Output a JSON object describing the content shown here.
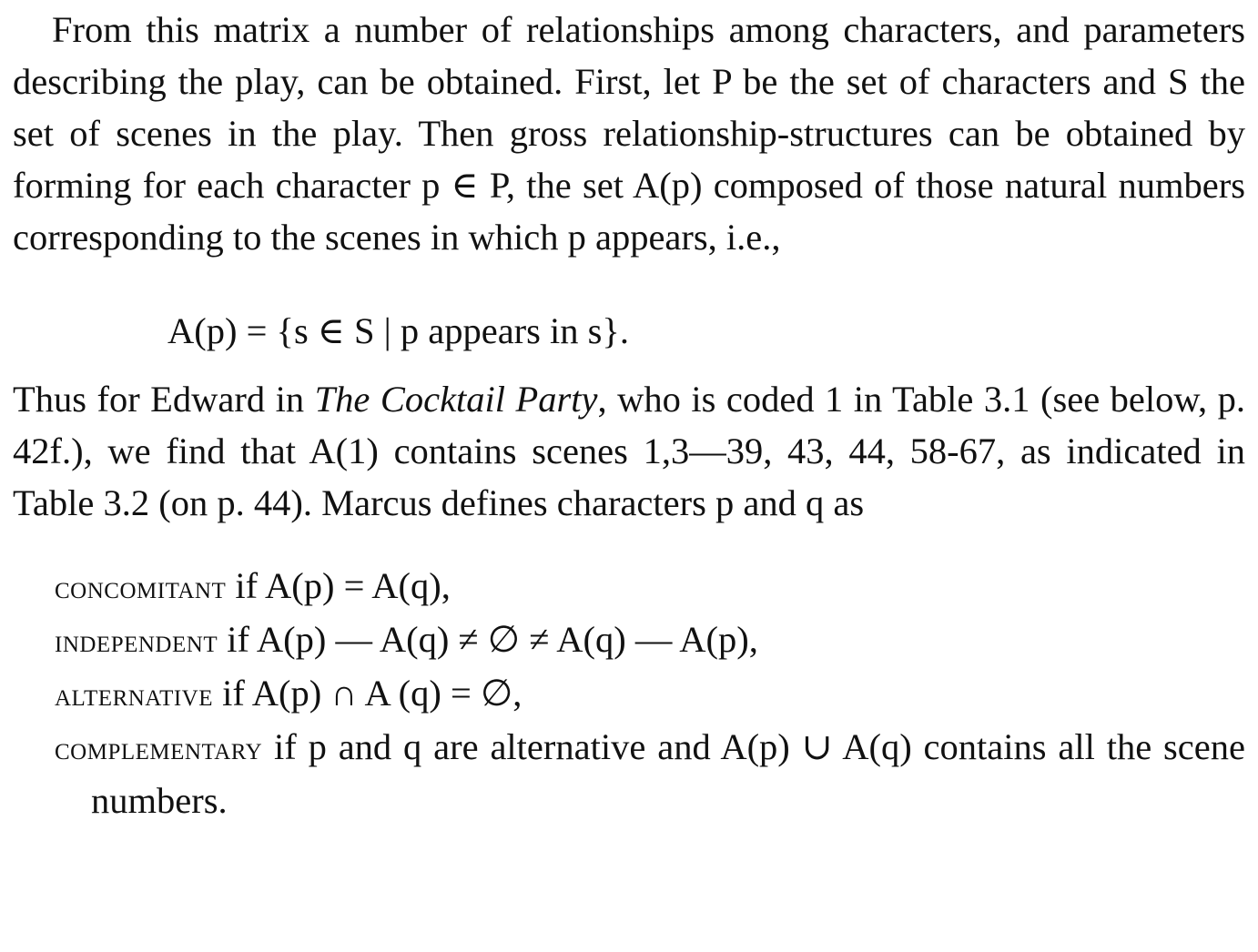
{
  "paragraph1": "From this matrix a number of relationships among characters, and parameters describing the play, can be obtained. First, let P be the set of characters and S the set of scenes in the play. Then gross relationship-structures can be obtained by forming for each character p ∈ P, the set A(p) composed of those natural numbers corresponding to the scenes in which p appears, i.e.,",
  "equation": "A(p) = {s ∈ S | p appears in s}.",
  "paragraph2": {
    "before_title": "Thus for Edward in ",
    "title": "The Cocktail Party",
    "after_title": ", who is coded 1 in Table 3.1 (see below, p. 42f.), we find that A(1) contains scenes 1,3—39, 43, 44, 58-67, as indicated in Table 3.2 (on p. 44). Marcus defines characters p and q as"
  },
  "definitions": [
    {
      "term": "CONCOMITANT",
      "text": " if A(p) = A(q),"
    },
    {
      "term": "INDEPENDENT",
      "text": " if A(p) — A(q) ≠ ∅ ≠ A(q) — A(p),"
    },
    {
      "term": "ALTERNATIVE",
      "text": " if A(p) ∩ A (q) = ∅,"
    },
    {
      "term": "COMPLEMENTARY",
      "text": " if p and q are alternative and A(p) ∪ A(q) contains all the scene numbers."
    }
  ]
}
